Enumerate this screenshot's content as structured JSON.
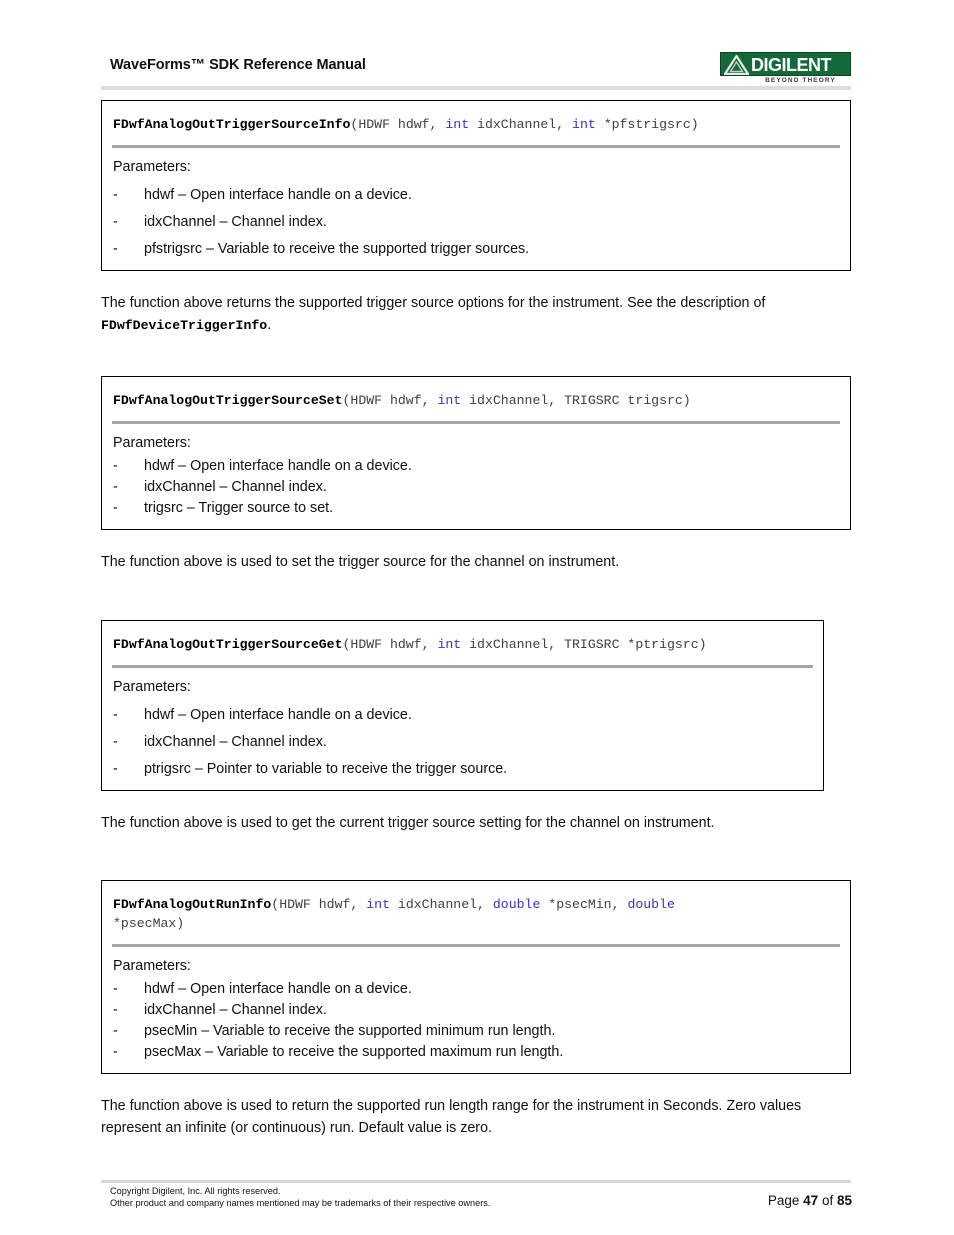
{
  "header": {
    "title": "WaveForms™ SDK Reference Manual",
    "logo": {
      "wordmark": "DIGILENT",
      "tagline": "BEYOND THEORY",
      "green": "#14693b",
      "triangle_fill": "#e8e8e8"
    }
  },
  "colors": {
    "keyword_blue": "#3333cc",
    "signature_gray": "#404040",
    "separator_gray": "#a6a6a6",
    "rule_gray": "#dcdcdc",
    "box_border": "#000000"
  },
  "sections": [
    {
      "box_width": "wide",
      "density": "loose",
      "signature": {
        "name": "FDwfAnalogOutTriggerSourceInfo",
        "tokens": [
          {
            "t": "(HDWF hdwf, ",
            "k": false
          },
          {
            "t": "int",
            "k": true
          },
          {
            "t": " idxChannel, ",
            "k": false
          },
          {
            "t": "int",
            "k": true
          },
          {
            "t": " *pfstrigsrc)",
            "k": false
          }
        ]
      },
      "params_label": "Parameters:",
      "params": [
        "hdwf – Open interface handle on a device.",
        "idxChannel – Channel index.",
        "pfstrigsrc – Variable to receive the supported trigger sources."
      ],
      "description_pre": "The function above returns the supported trigger source options for the instrument. See the description of ",
      "description_mono": "FDwfDeviceTriggerInfo",
      "description_post": "."
    },
    {
      "box_width": "wide",
      "density": "tight",
      "signature": {
        "name": "FDwfAnalogOutTriggerSourceSet",
        "tokens": [
          {
            "t": "(HDWF hdwf, ",
            "k": false
          },
          {
            "t": "int",
            "k": true
          },
          {
            "t": " idxChannel, TRIGSRC trigsrc)",
            "k": false
          }
        ]
      },
      "params_label": "Parameters:",
      "params": [
        "hdwf – Open interface handle on a device.",
        "idxChannel – Channel index.",
        "trigsrc – Trigger source to set."
      ],
      "description_pre": "The function above is used to set the trigger source for the channel on instrument.",
      "description_mono": "",
      "description_post": ""
    },
    {
      "box_width": "narrow",
      "density": "loose",
      "signature": {
        "name": "FDwfAnalogOutTriggerSourceGet",
        "tokens": [
          {
            "t": "(HDWF hdwf, ",
            "k": false
          },
          {
            "t": "int",
            "k": true
          },
          {
            "t": " idxChannel, TRIGSRC *ptrigsrc)",
            "k": false
          }
        ]
      },
      "params_label": "Parameters:",
      "params": [
        "hdwf – Open interface handle on a device.",
        "idxChannel – Channel index.",
        "ptrigsrc – Pointer to variable to receive the trigger source."
      ],
      "description_pre": "The function above is used to get the current trigger source setting for the channel on instrument.",
      "description_mono": "",
      "description_post": ""
    },
    {
      "box_width": "wide",
      "density": "tight",
      "signature": {
        "name": "FDwfAnalogOutRunInfo",
        "tokens": [
          {
            "t": "(HDWF hdwf, ",
            "k": false
          },
          {
            "t": "int",
            "k": true
          },
          {
            "t": " idxChannel, ",
            "k": false
          },
          {
            "t": "double",
            "k": true
          },
          {
            "t": " *psecMin, ",
            "k": false
          },
          {
            "t": "double",
            "k": true
          },
          {
            "t": "\n*psecMax)",
            "k": false
          }
        ]
      },
      "params_label": "Parameters:",
      "params": [
        "hdwf – Open interface handle on a device.",
        "idxChannel – Channel index.",
        "psecMin – Variable to receive the supported minimum run length.",
        "psecMax – Variable to receive the supported maximum run length."
      ],
      "description_pre": "The function above is used to return the supported run length range for the instrument in Seconds.  Zero values represent an infinite (or continuous) run. Default value is zero.",
      "description_mono": "",
      "description_post": ""
    }
  ],
  "footer": {
    "copyright_line1": "Copyright Digilent, Inc. All rights reserved.",
    "copyright_line2": "Other product and company names mentioned may be trademarks of their respective owners.",
    "page_prefix": "Page ",
    "page_number": "47",
    "page_middle": " of ",
    "page_total": "85"
  }
}
